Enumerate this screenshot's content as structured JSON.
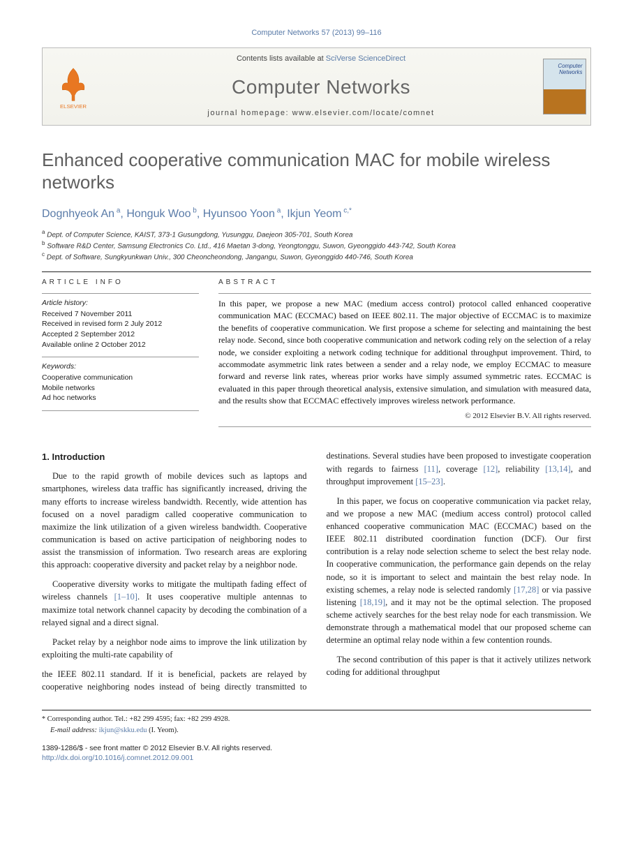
{
  "citation": {
    "journal": "Computer Networks",
    "volume_issue_pages": "57 (2013) 99–116"
  },
  "header": {
    "contents_prefix": "Contents lists available at",
    "contents_link": "SciVerse ScienceDirect",
    "journal_name": "Computer Networks",
    "homepage_label": "journal homepage:",
    "homepage_url": "www.elsevier.com/locate/comnet",
    "publisher": "ELSEVIER"
  },
  "title": "Enhanced cooperative communication MAC for mobile wireless networks",
  "authors": [
    {
      "name": "Dognhyeok An",
      "affil": "a"
    },
    {
      "name": "Honguk Woo",
      "affil": "b"
    },
    {
      "name": "Hyunsoo Yoon",
      "affil": "a"
    },
    {
      "name": "Ikjun Yeom",
      "affil": "c,*"
    }
  ],
  "affiliations": {
    "a": "Dept. of Computer Science, KAIST, 373-1 Gusungdong, Yusunggu, Daejeon 305-701, South Korea",
    "b": "Software R&D Center, Samsung Electronics Co. Ltd., 416 Maetan 3-dong, Yeongtonggu, Suwon, Gyeonggido 443-742, South Korea",
    "c": "Dept. of Software, Sungkyunkwan Univ., 300 Cheoncheondong, Jangangu, Suwon, Gyeonggido 440-746, South Korea"
  },
  "article_info": {
    "heading": "ARTICLE INFO",
    "history_title": "Article history:",
    "received": "Received 7 November 2011",
    "revised": "Received in revised form 2 July 2012",
    "accepted": "Accepted 2 September 2012",
    "online": "Available online 2 October 2012",
    "keywords_title": "Keywords:",
    "keywords": [
      "Cooperative communication",
      "Mobile networks",
      "Ad hoc networks"
    ]
  },
  "abstract": {
    "heading": "ABSTRACT",
    "text": "In this paper, we propose a new MAC (medium access control) protocol called enhanced cooperative communication MAC (ECCMAC) based on IEEE 802.11. The major objective of ECCMAC is to maximize the benefits of cooperative communication. We first propose a scheme for selecting and maintaining the best relay node. Second, since both cooperative communication and network coding rely on the selection of a relay node, we consider exploiting a network coding technique for additional throughput improvement. Third, to accommodate asymmetric link rates between a sender and a relay node, we employ ECCMAC to measure forward and reverse link rates, whereas prior works have simply assumed symmetric rates. ECCMAC is evaluated in this paper through theoretical analysis, extensive simulation, and simulation with measured data, and the results show that ECCMAC effectively improves wireless network performance.",
    "copyright": "© 2012 Elsevier B.V. All rights reserved."
  },
  "body": {
    "section_heading": "1. Introduction",
    "p1": "Due to the rapid growth of mobile devices such as laptops and smartphones, wireless data traffic has significantly increased, driving the many efforts to increase wireless bandwidth. Recently, wide attention has focused on a novel paradigm called cooperative communication to maximize the link utilization of a given wireless bandwidth. Cooperative communication is based on active participation of neighboring nodes to assist the transmission of information. Two research areas are exploring this approach: cooperative diversity and packet relay by a neighbor node.",
    "p2_a": "Cooperative diversity works to mitigate the multipath fading effect of wireless channels ",
    "p2_ref1": "[1–10]",
    "p2_b": ". It uses cooperative multiple antennas to maximize total network channel capacity by decoding the combination of a relayed signal and a direct signal.",
    "p3": "Packet relay by a neighbor node aims to improve the link utilization by exploiting the multi-rate capability of",
    "p4_a": "the IEEE 802.11 standard. If it is beneficial, packets are relayed by cooperative neighboring nodes instead of being directly transmitted to destinations. Several studies have been proposed to investigate cooperation with regards to fairness ",
    "p4_ref1": "[11]",
    "p4_b": ", coverage ",
    "p4_ref2": "[12]",
    "p4_c": ", reliability ",
    "p4_ref3": "[13,14]",
    "p4_d": ", and throughput improvement ",
    "p4_ref4": "[15–23]",
    "p4_e": ".",
    "p5_a": "In this paper, we focus on cooperative communication via packet relay, and we propose a new MAC (medium access control) protocol called enhanced cooperative communication MAC (ECCMAC) based on the IEEE 802.11 distributed coordination function (DCF). Our first contribution is a relay node selection scheme to select the best relay node. In cooperative communication, the performance gain depends on the relay node, so it is important to select and maintain the best relay node. In existing schemes, a relay node is selected randomly ",
    "p5_ref1": "[17,28]",
    "p5_b": " or via passive listening ",
    "p5_ref2": "[18,19]",
    "p5_c": ", and it may not be the optimal selection. The proposed scheme actively searches for the best relay node for each transmission. We demonstrate through a mathematical model that our proposed scheme can determine an optimal relay node within a few contention rounds.",
    "p6": "The second contribution of this paper is that it actively utilizes network coding for additional throughput"
  },
  "footnotes": {
    "corr_label": "* Corresponding author.",
    "tel": "Tel.: +82 299 4595; fax: +82 299 4928.",
    "email_label": "E-mail address:",
    "email": "ikjun@skku.edu",
    "email_who": "(I. Yeom)."
  },
  "bottom": {
    "issn_line": "1389-1286/$ - see front matter © 2012 Elsevier B.V. All rights reserved.",
    "doi": "http://dx.doi.org/10.1016/j.comnet.2012.09.001"
  }
}
